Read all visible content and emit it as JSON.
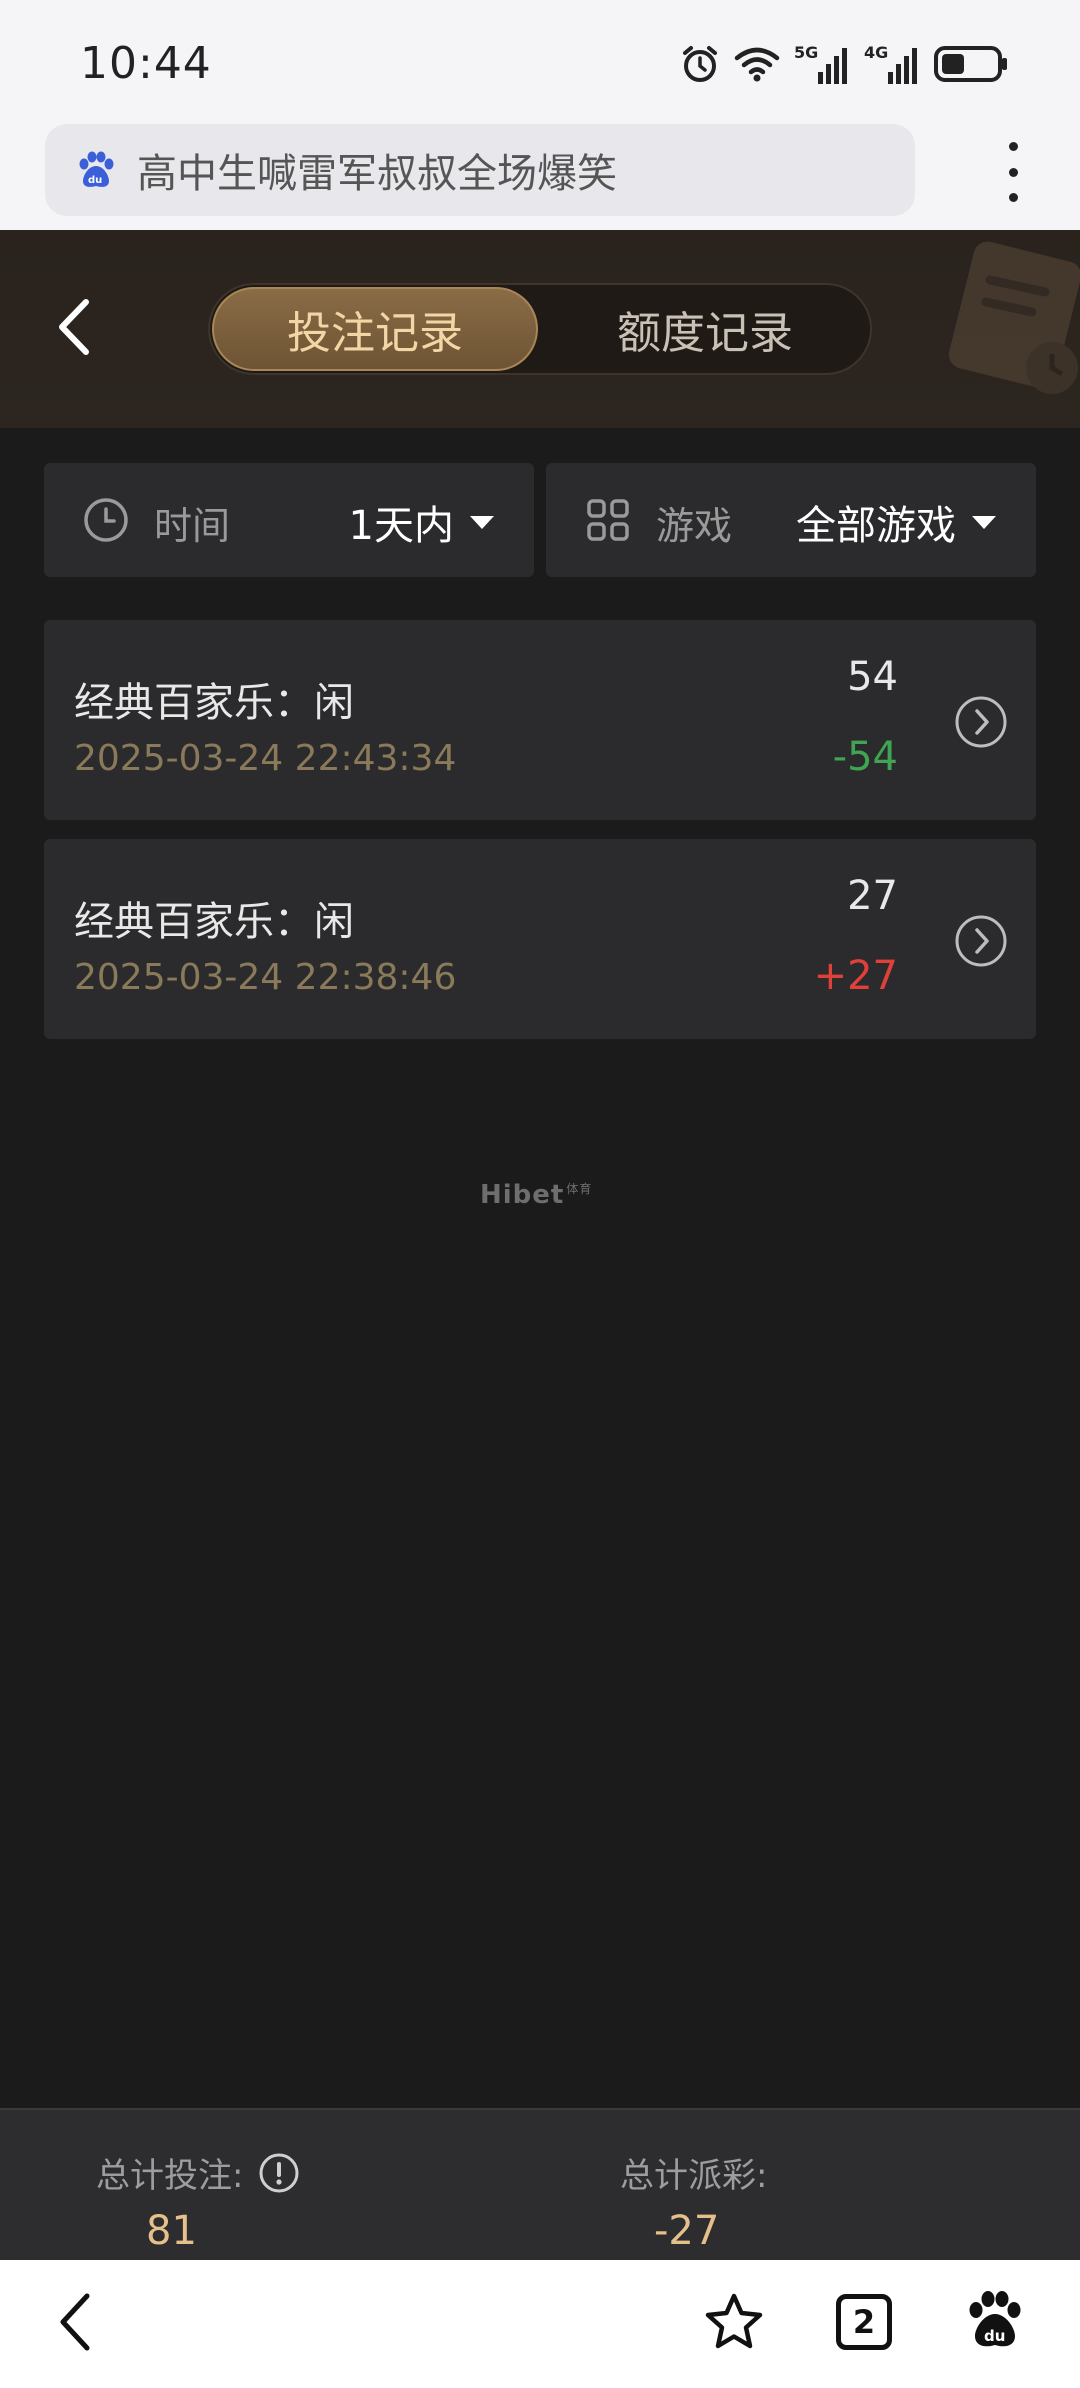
{
  "status_bar": {
    "time": "10:44",
    "icons": [
      "alarm-icon",
      "wifi-icon",
      "signal-5g-icon",
      "signal-4g-icon",
      "battery-icon"
    ],
    "signal_5g": "5G",
    "signal_4g": "4G"
  },
  "browser": {
    "search_text": "高中生喊雷军叔叔全场爆笑",
    "tab_count": "2"
  },
  "header": {
    "tabs": [
      {
        "label": "投注记录",
        "active": true
      },
      {
        "label": "额度记录",
        "active": false
      }
    ]
  },
  "filters": {
    "time": {
      "label": "时间",
      "value": "1天内"
    },
    "game": {
      "label": "游戏",
      "value": "全部游戏"
    }
  },
  "records": [
    {
      "title": "经典百家乐：闲",
      "timestamp": "2025-03-24 22:43:34",
      "bet": "54",
      "payout": "-54"
    },
    {
      "title": "经典百家乐：闲",
      "timestamp": "2025-03-24 22:38:46",
      "bet": "27",
      "payout": "+27"
    }
  ],
  "watermark": {
    "brand": "Hibet",
    "sub": "体育"
  },
  "summary": {
    "total_bet_label": "总计投注:",
    "total_bet_value": "81",
    "total_payout_label": "总计派彩:",
    "total_payout_value": "-27"
  },
  "colors": {
    "accent_gold": "#e6c08a",
    "payout_negative": "#3fa552",
    "payout_positive": "#e0403a",
    "background": "#1b1b1b",
    "card": "#2b2b2d"
  }
}
